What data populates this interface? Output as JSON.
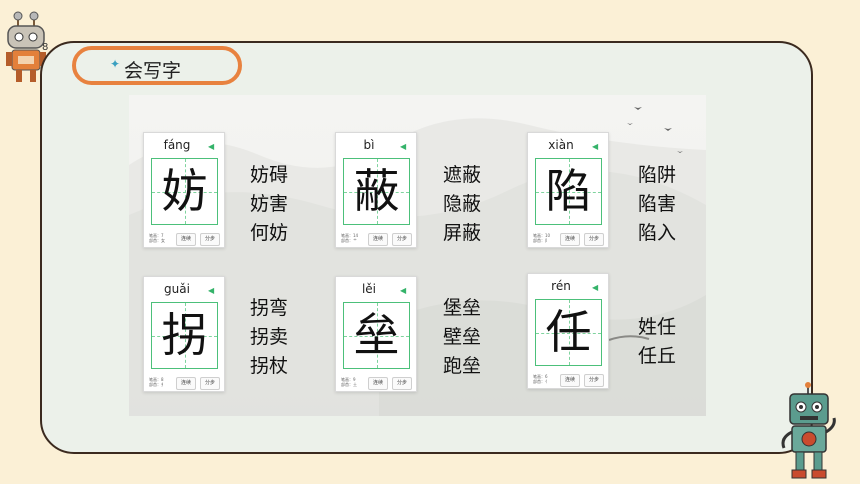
{
  "title": "会写字",
  "buttons": {
    "continuous": "连续",
    "step": "分步"
  },
  "cards": [
    {
      "pinyin": "fáng",
      "char": "妨",
      "strokes_label": "笔画：7",
      "radical_label": "部首：女",
      "words": [
        "妨碍",
        "妨害",
        "何妨"
      ]
    },
    {
      "pinyin": "bì",
      "char": "蔽",
      "strokes_label": "笔画：14",
      "radical_label": "部首：艹",
      "words": [
        "遮蔽",
        "隐蔽",
        "屏蔽"
      ]
    },
    {
      "pinyin": "xiàn",
      "char": "陷",
      "strokes_label": "笔画：10",
      "radical_label": "部首：阝",
      "words": [
        "陷阱",
        "陷害",
        "陷入"
      ]
    },
    {
      "pinyin": "guǎi",
      "char": "拐",
      "strokes_label": "笔画：8",
      "radical_label": "部首：扌",
      "words": [
        "拐弯",
        "拐卖",
        "拐杖"
      ]
    },
    {
      "pinyin": "lěi",
      "char": "垒",
      "strokes_label": "笔画：9",
      "radical_label": "部首：土",
      "words": [
        "堡垒",
        "壁垒",
        "跑垒"
      ]
    },
    {
      "pinyin": "rén",
      "char": "任",
      "strokes_label": "笔画：6",
      "radical_label": "部首：亻",
      "words": [
        "姓任",
        "任丘"
      ]
    }
  ],
  "icons": {
    "sound": "speaker-icon",
    "robot": "robot-mascot-icon",
    "bird": "bird-icon"
  },
  "colors": {
    "page_bg": "#fbf0d6",
    "panel_bg": "#ecf1ea",
    "pill_border": "#e8823f",
    "grid_green": "#4cc07a"
  }
}
